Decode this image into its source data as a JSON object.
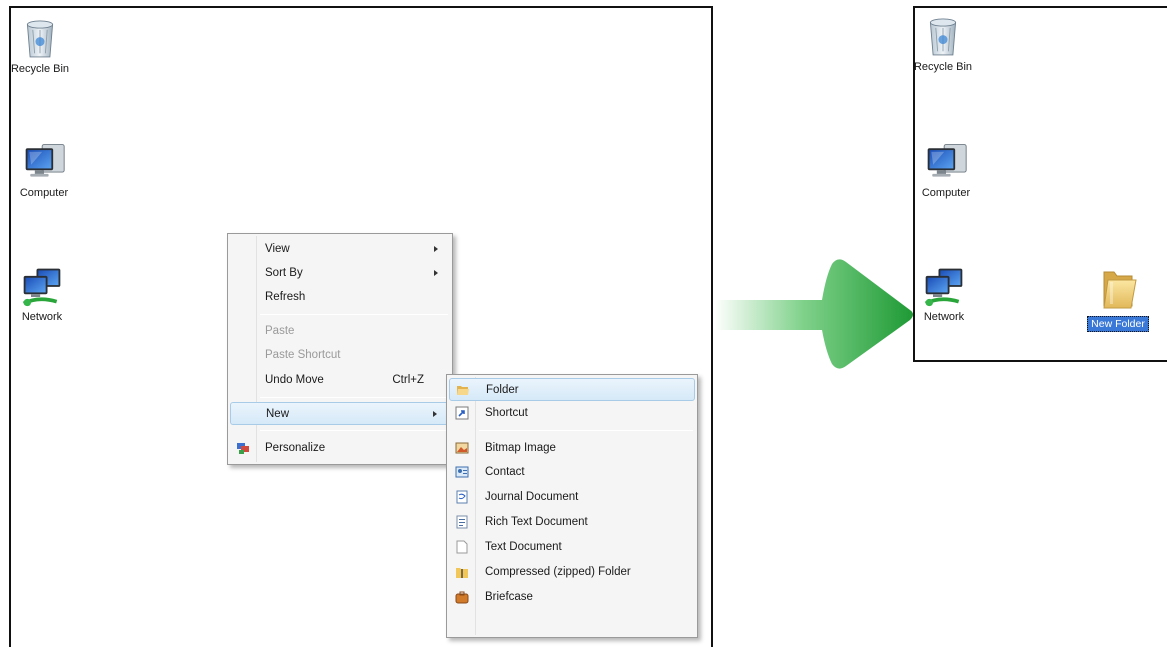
{
  "left_desktop": {
    "icons": [
      {
        "label": "Recycle Bin"
      },
      {
        "label": "Computer"
      },
      {
        "label": "Network"
      }
    ]
  },
  "context_menu": {
    "items": [
      {
        "label": "View",
        "has_submenu": true
      },
      {
        "label": "Sort By",
        "has_submenu": true
      },
      {
        "label": "Refresh"
      },
      {
        "label": "Paste",
        "disabled": true
      },
      {
        "label": "Paste Shortcut",
        "disabled": true
      },
      {
        "label": "Undo Move",
        "shortcut": "Ctrl+Z"
      },
      {
        "label": "New",
        "has_submenu": true,
        "highlighted": true
      },
      {
        "label": "Personalize",
        "icon": "personalize-icon"
      }
    ]
  },
  "new_submenu": {
    "items": [
      {
        "label": "Folder",
        "icon": "folder-icon",
        "highlighted": true
      },
      {
        "label": "Shortcut",
        "icon": "shortcut-icon"
      },
      {
        "label": "Bitmap Image",
        "icon": "bitmap-image-icon"
      },
      {
        "label": "Contact",
        "icon": "contact-icon"
      },
      {
        "label": "Journal Document",
        "icon": "journal-document-icon"
      },
      {
        "label": "Rich Text Document",
        "icon": "rich-text-document-icon"
      },
      {
        "label": "Text Document",
        "icon": "text-document-icon"
      },
      {
        "label": "Compressed (zipped) Folder",
        "icon": "zipped-folder-icon"
      },
      {
        "label": "Briefcase",
        "icon": "briefcase-icon"
      }
    ]
  },
  "right_desktop": {
    "icons": [
      {
        "label": "Recycle Bin"
      },
      {
        "label": "Computer"
      },
      {
        "label": "Network"
      }
    ],
    "new_folder": {
      "label": "New Folder",
      "editing": true
    }
  },
  "colors": {
    "arrow": "#2aa53a",
    "selection": "#3a78d8",
    "menu_highlight": "#d6e9f8"
  }
}
